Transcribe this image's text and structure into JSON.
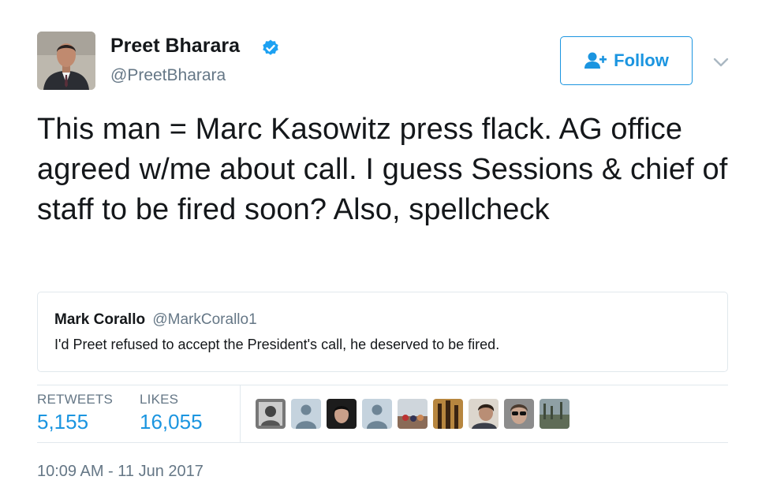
{
  "author": {
    "name": "Preet Bharara",
    "handle": "@PreetBharara",
    "verified": true,
    "avatar_icon": "profile-photo"
  },
  "actions": {
    "follow_label": "Follow",
    "follow_icon": "add-user-icon",
    "menu_icon": "chevron-down-icon"
  },
  "tweet": {
    "text": "This man = Marc Kasowitz press flack. AG office agreed w/me about call. I guess Sessions & chief of staff to be fired soon? Also, spellcheck"
  },
  "quoted_tweet": {
    "name": "Mark Corallo",
    "handle": "@MarkCorallo1",
    "text": "I'd Preet refused to accept the President's call, he deserved to be fired."
  },
  "stats": {
    "retweets_label": "RETWEETS",
    "retweets_value": "5,155",
    "likes_label": "LIKES",
    "likes_value": "16,055"
  },
  "likers": [
    "liker-avatar-1",
    "liker-avatar-2",
    "liker-avatar-3",
    "liker-avatar-4",
    "liker-avatar-5",
    "liker-avatar-6",
    "liker-avatar-7",
    "liker-avatar-8",
    "liker-avatar-9"
  ],
  "timestamp": "10:09 AM - 11 Jun 2017",
  "colors": {
    "accent": "#1b95e0",
    "text": "#14171a",
    "secondary": "#657786",
    "border": "#e1e8ed"
  }
}
